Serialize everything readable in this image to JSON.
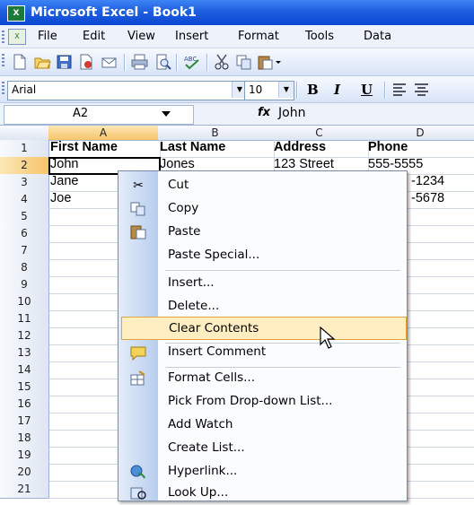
{
  "window": {
    "title": "Microsoft Excel - Book1"
  },
  "menubar": {
    "items": [
      {
        "label": "File"
      },
      {
        "label": "Edit"
      },
      {
        "label": "View"
      },
      {
        "label": "Insert"
      },
      {
        "label": "Format"
      },
      {
        "label": "Tools"
      },
      {
        "label": "Data"
      }
    ]
  },
  "toolbar": {
    "icons": [
      "new-icon",
      "open-icon",
      "save-icon",
      "permission-icon",
      "print-icon",
      "print-preview-icon",
      "spelling-icon",
      "cut-icon",
      "copy-icon",
      "paste-icon"
    ]
  },
  "format_toolbar": {
    "font": "Arial",
    "size": "10",
    "bold": "B",
    "italic": "I",
    "underline": "U"
  },
  "formula_bar": {
    "name_box": "A2",
    "fx": "fx",
    "value": "John"
  },
  "grid": {
    "columns": [
      "A",
      "B",
      "C",
      "D"
    ],
    "rows": [
      "1",
      "2",
      "3",
      "4",
      "5",
      "6",
      "7",
      "8",
      "9",
      "10",
      "11",
      "12",
      "13",
      "14",
      "15",
      "16",
      "17",
      "18",
      "19",
      "20",
      "21"
    ],
    "headers": [
      "First Name",
      "Last Name",
      "Address",
      "Phone"
    ],
    "data": [
      {
        "a": "John",
        "b": "Jones",
        "c": "123 Street",
        "d": "555-5555"
      },
      {
        "a": "Jane",
        "d": "-1234"
      },
      {
        "a": "Joe",
        "d": "-5678"
      }
    ]
  },
  "context_menu": {
    "items": [
      {
        "label": "Cut",
        "icon": "scissors-icon"
      },
      {
        "label": "Copy",
        "icon": "copy-icon"
      },
      {
        "label": "Paste",
        "icon": "paste-icon"
      },
      {
        "label": "Paste Special..."
      },
      {
        "label": "Insert..."
      },
      {
        "label": "Delete..."
      },
      {
        "label": "Clear Contents",
        "highlighted": true
      },
      {
        "label": "Insert Comment",
        "icon": "comment-icon"
      },
      {
        "label": "Format Cells...",
        "icon": "format-cells-icon"
      },
      {
        "label": "Pick From Drop-down List..."
      },
      {
        "label": "Add Watch"
      },
      {
        "label": "Create List..."
      },
      {
        "label": "Hyperlink...",
        "icon": "hyperlink-icon"
      },
      {
        "label": "Look Up...",
        "icon": "lookup-icon"
      }
    ]
  },
  "colors": {
    "highlight": "#ffeec2",
    "title_bar": "#0a46d3",
    "selection_header": "#f7c46a"
  }
}
